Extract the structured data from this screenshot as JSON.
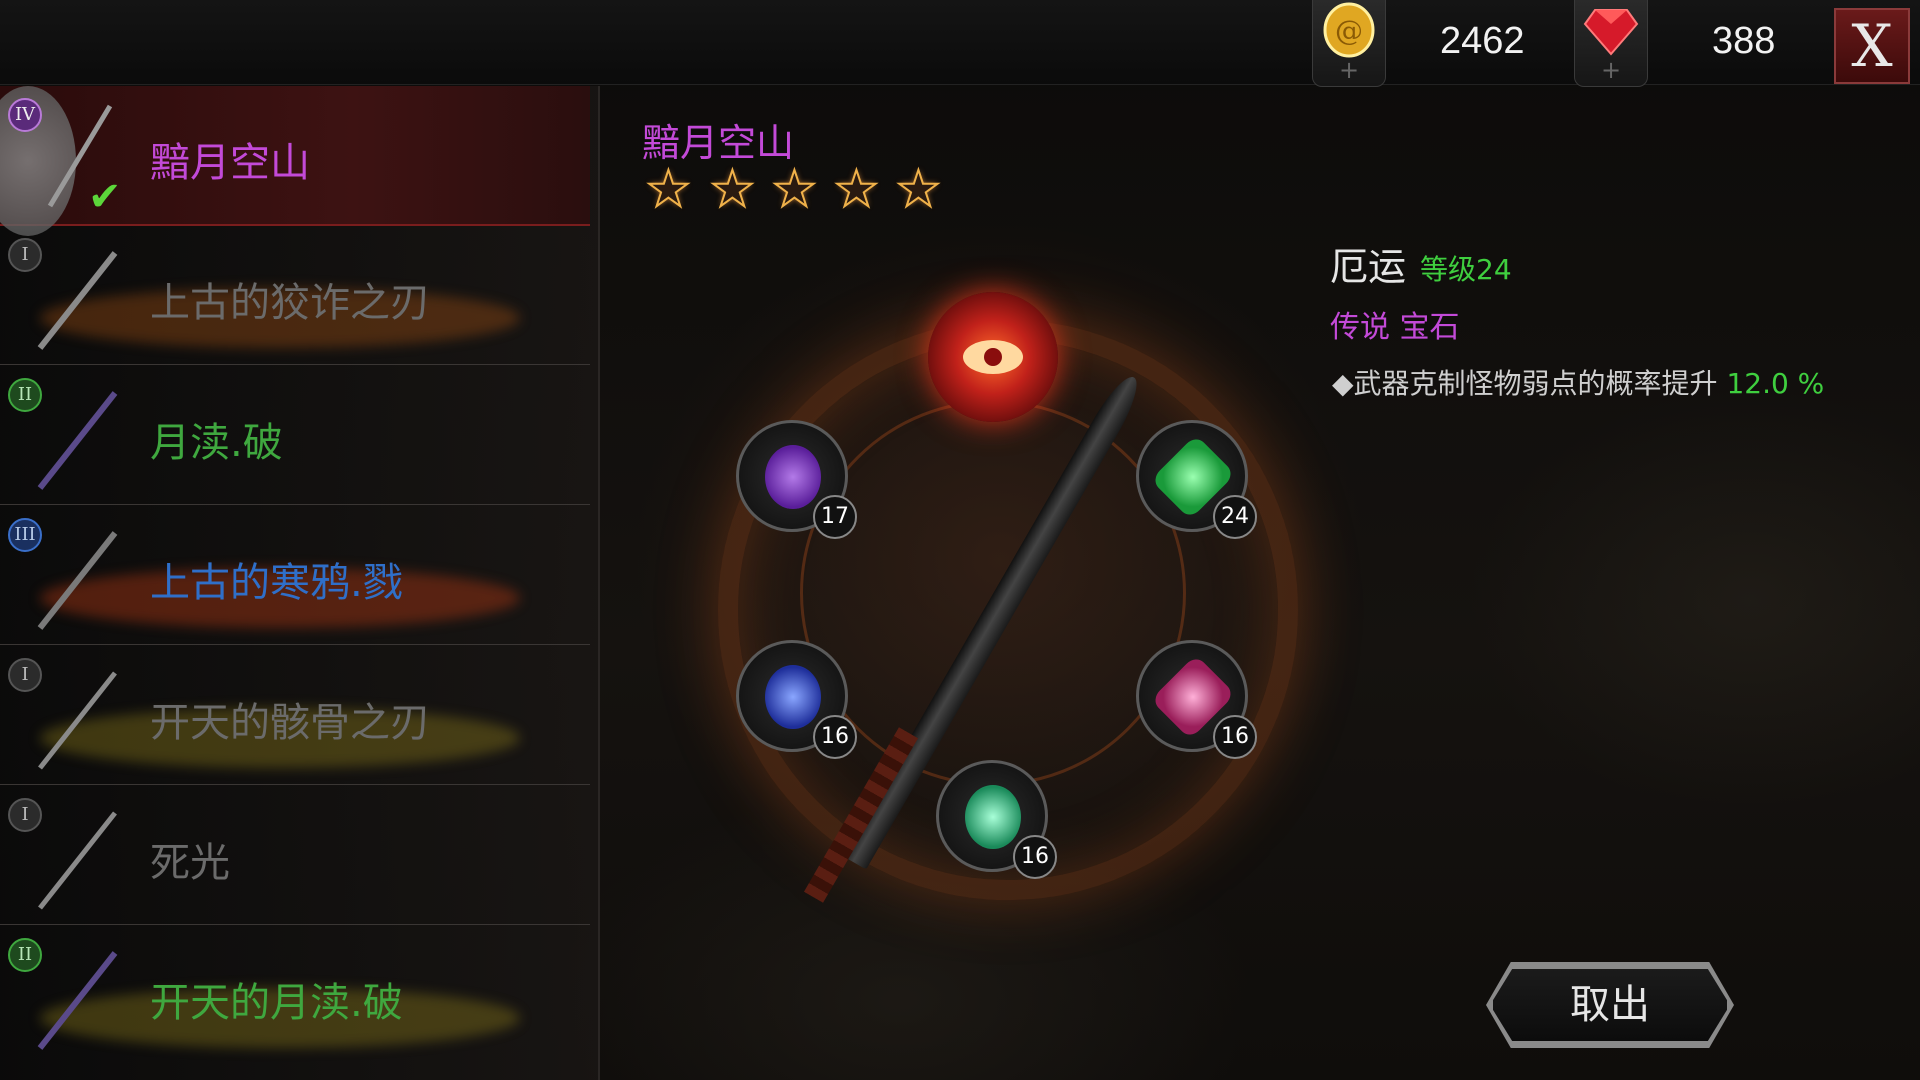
{
  "currency": {
    "gold": "2462",
    "gems": "388",
    "gold_icon": "gold-coin-icon",
    "gem_icon": "ruby-icon"
  },
  "close_button": "X",
  "weapon_list": [
    {
      "tier": "IV",
      "name": "黯月空山",
      "color": "#c34ad8",
      "selected": true
    },
    {
      "tier": "I",
      "name": "上古的狡诈之刃",
      "color": "#6b6b6b"
    },
    {
      "tier": "II",
      "name": "月渎.破",
      "color": "#3fa83f"
    },
    {
      "tier": "III",
      "name": "上古的寒鸦.戮",
      "color": "#2f6fc9"
    },
    {
      "tier": "I",
      "name": "开天的骸骨之刃",
      "color": "#6b6b6b"
    },
    {
      "tier": "I",
      "name": "死光",
      "color": "#6b6b6b"
    },
    {
      "tier": "II",
      "name": "开天的月渎.破",
      "color": "#3fa83f"
    }
  ],
  "detail": {
    "weapon_name": "黯月空山",
    "stars": 5,
    "main_gem_icon": "red-eye-gem-icon",
    "slots": [
      {
        "level": "17",
        "icon": "purple-gem-icon"
      },
      {
        "level": "24",
        "icon": "green-crystal-icon"
      },
      {
        "level": "16",
        "icon": "blue-gem-icon"
      },
      {
        "level": "16",
        "icon": "pink-gem-icon"
      },
      {
        "level": "16",
        "icon": "teal-gem-icon"
      }
    ]
  },
  "gem_info": {
    "name": "厄运",
    "level": "等级24",
    "rarity": "传说 宝石",
    "effect_text": "◆武器克制怪物弱点的概率提升 ",
    "effect_value": "12.0 %"
  },
  "extract_button": "取出"
}
